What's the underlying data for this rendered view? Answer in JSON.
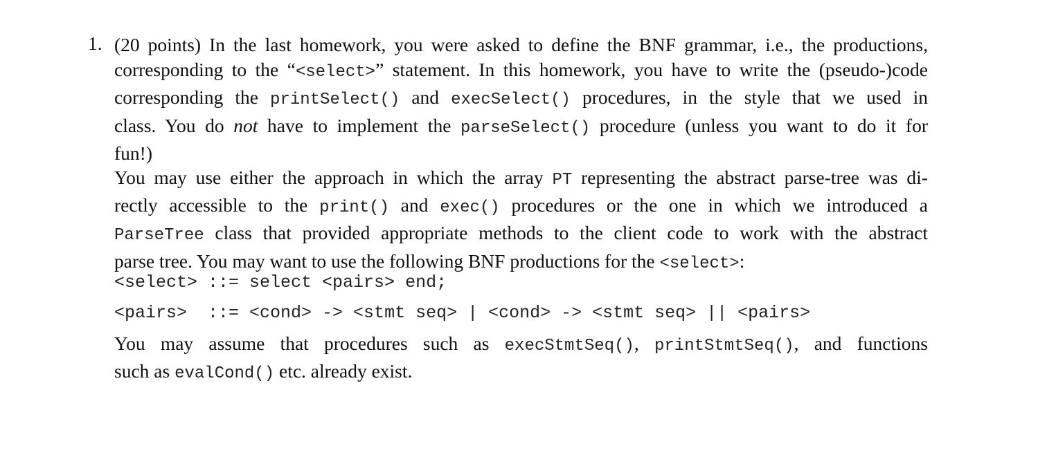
{
  "problem": {
    "number": "1.",
    "para1": [
      [
        {
          "t": "(20 points) In the last homework, you were asked to define the BNF grammar, i.e., the productions,"
        }
      ],
      [
        {
          "t": "corresponding to the “"
        },
        {
          "c": "<select>"
        },
        {
          "t": "” statement. In this homework, you have to write the (pseudo-)code"
        }
      ],
      [
        {
          "t": "corresponding the "
        },
        {
          "c": "printSelect()"
        },
        {
          "t": " and "
        },
        {
          "c": "execSelect()"
        },
        {
          "t": " procedures, in the style that we used in"
        }
      ],
      [
        {
          "t": "class.  You do "
        },
        {
          "i": "not"
        },
        {
          "t": " have to implement the "
        },
        {
          "c": "parseSelect()"
        },
        {
          "t": " procedure (unless you want to do it for"
        }
      ],
      [
        {
          "t": "fun!)"
        }
      ]
    ],
    "para2": [
      [
        {
          "t": "You may use either the approach in which the array "
        },
        {
          "c": "PT"
        },
        {
          "t": " representing the abstract parse-tree was di-"
        }
      ],
      [
        {
          "t": "rectly accessible to the "
        },
        {
          "c": "print()"
        },
        {
          "t": " and "
        },
        {
          "c": "exec()"
        },
        {
          "t": " procedures or the one in which we introduced a"
        }
      ],
      [
        {
          "c": "ParseTree"
        },
        {
          "t": " class that provided appropriate methods to the client code to work with the abstract"
        }
      ],
      [
        {
          "t": "parse tree. You may want to use the following BNF productions for the "
        },
        {
          "c": "<select>"
        },
        {
          "t": ":"
        }
      ]
    ],
    "grammar": [
      "<select> ::= select <pairs> end;",
      "<pairs>  ::= <cond> -> <stmt seq> | <cond> -> <stmt seq> || <pairs>"
    ],
    "para3": [
      [
        {
          "t": "You may assume that procedures such as "
        },
        {
          "c": "execStmtSeq()"
        },
        {
          "t": ", "
        },
        {
          "c": "printStmtSeq()"
        },
        {
          "t": ", and functions"
        }
      ],
      [
        {
          "t": "such as "
        },
        {
          "c": "evalCond()"
        },
        {
          "t": " etc. already exist."
        }
      ]
    ]
  }
}
